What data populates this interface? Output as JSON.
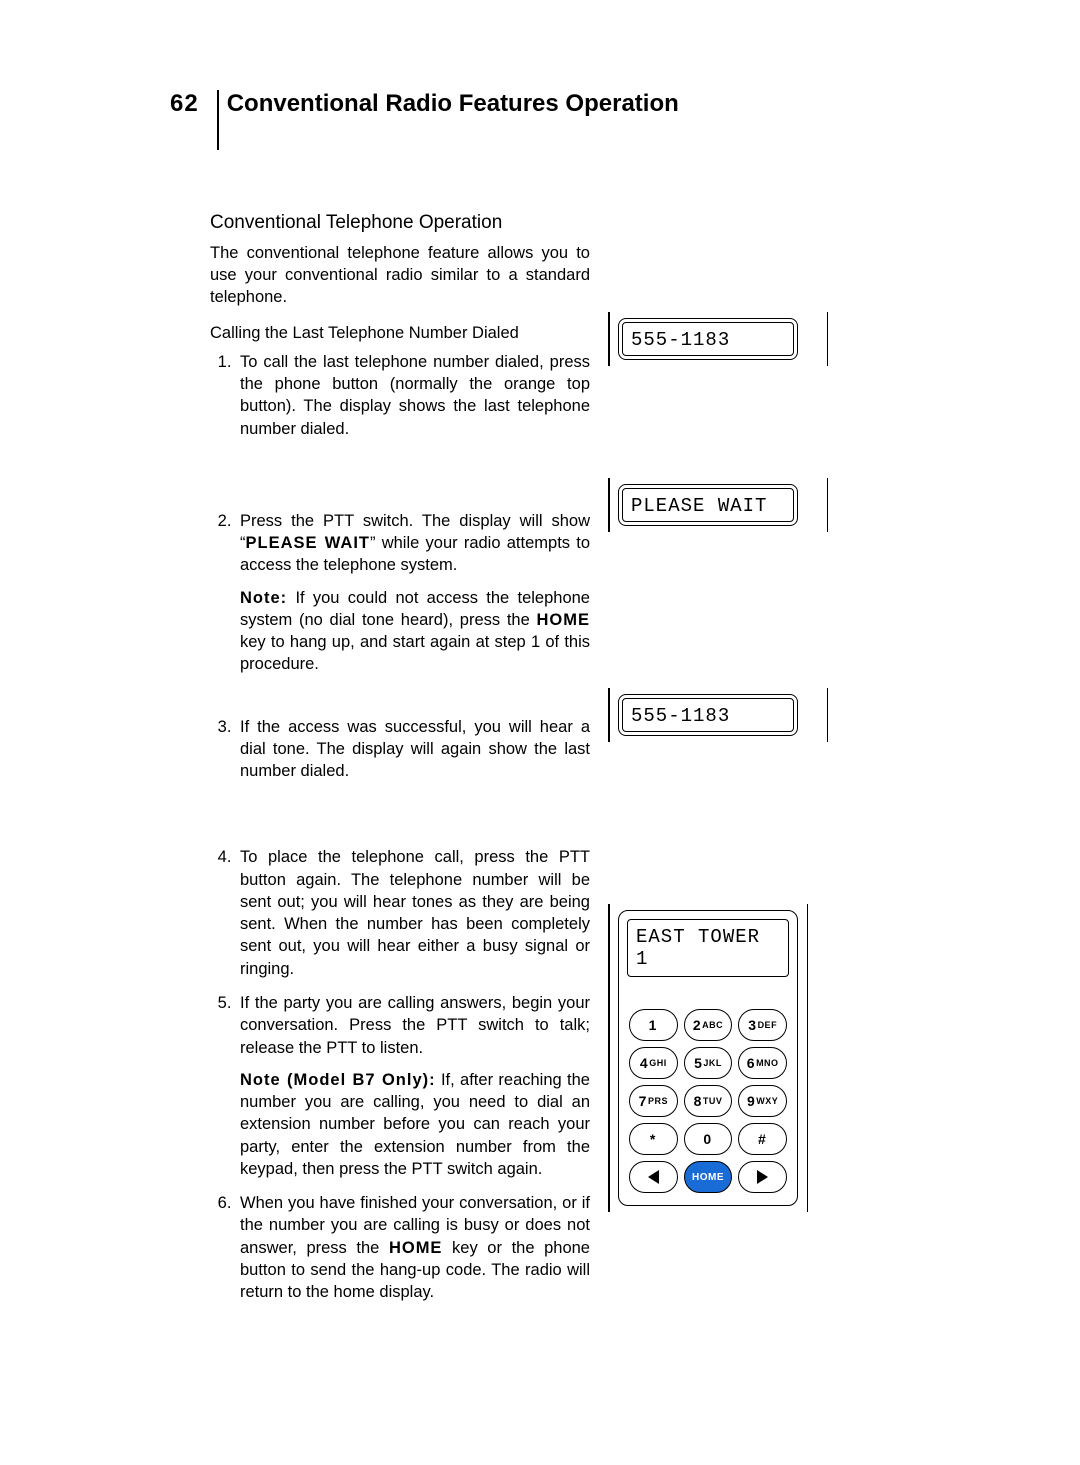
{
  "page_number": "62",
  "chapter_title": "Conventional Radio Features Operation",
  "section_title": "Conventional Telephone Operation",
  "intro": "The conventional telephone feature allows you to use your conventional radio similar to a standard telephone.",
  "subhead": "Calling the Last Telephone Number Dialed",
  "steps": {
    "s1": "To call the last telephone number dialed, press the phone button (normally the orange top button). The display shows the last telephone number dialed.",
    "s2_a": "Press the PTT switch. The display will show “",
    "s2_bold": "PLEASE WAIT",
    "s2_b": "” while your radio attempts to access the telephone system.",
    "s2_note_label": "Note:",
    "s2_note_a": " If you could not access the telephone system (no dial tone heard), press the ",
    "s2_note_bold": "HOME",
    "s2_note_b": " key to hang up, and start again at step 1 of this procedure.",
    "s3": "If the access was successful, you will hear a dial tone. The display will again show the last number dialed.",
    "s4": "To place the telephone call, press the PTT button again. The telephone number will be sent out; you will hear tones as they are being sent. When the number has been completely sent out, you will hear either a busy signal or ringing.",
    "s5": "If the party you are calling answers, begin your conversation. Press the PTT switch to talk; release the PTT to listen.",
    "s5_note_label": "Note (Model B7 Only):",
    "s5_note": " If, after reaching the number you are calling, you need to dial an extension number before you can reach your party, enter the extension number from the keypad, then press the PTT switch again.",
    "s6_a": "When you have finished your conversation, or if the number you are calling is busy or does not answer, press the ",
    "s6_bold": "HOME",
    "s6_b": " key or the phone button to send the hang-up code. The radio will return to the home display."
  },
  "displays": {
    "d1": "555-1183",
    "d2": "PLEASE WAIT",
    "d3": "555-1183",
    "d4": "EAST TOWER 1"
  },
  "keypad": {
    "keys": [
      {
        "d": "1",
        "l": ""
      },
      {
        "d": "2",
        "l": "ABC"
      },
      {
        "d": "3",
        "l": "DEF"
      },
      {
        "d": "4",
        "l": "GHI"
      },
      {
        "d": "5",
        "l": "JKL"
      },
      {
        "d": "6",
        "l": "MNO"
      },
      {
        "d": "7",
        "l": "PRS"
      },
      {
        "d": "8",
        "l": "TUV"
      },
      {
        "d": "9",
        "l": "WXY"
      },
      {
        "d": "*",
        "l": ""
      },
      {
        "d": "0",
        "l": ""
      },
      {
        "d": "#",
        "l": ""
      }
    ],
    "home": "HOME"
  }
}
